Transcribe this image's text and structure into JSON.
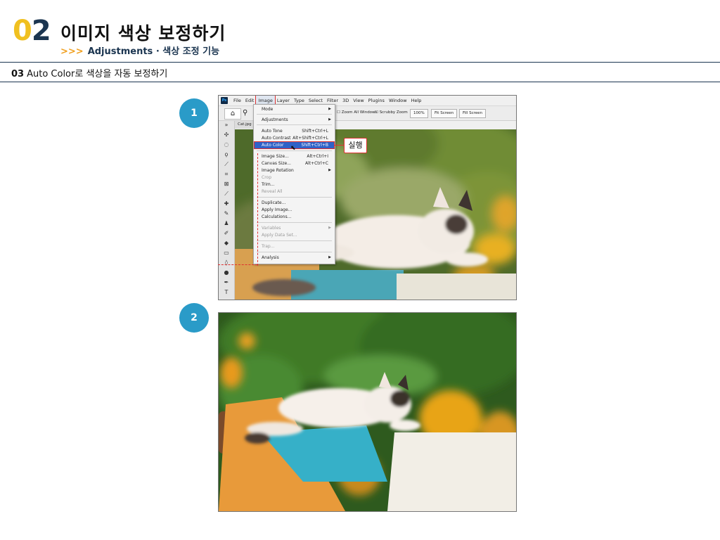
{
  "header": {
    "chapter_num_a": "0",
    "chapter_num_b": "2",
    "title": "이미지 색상 보정하기",
    "subtitle_arrows": ">>>",
    "subtitle": "Adjustments · 색상 조정 기능"
  },
  "step": {
    "number": "03",
    "title": "Auto Color로 색상을 자동 보정하기"
  },
  "badges": [
    "1",
    "2"
  ],
  "photoshop": {
    "logo": "Ps",
    "menubar": [
      "File",
      "Edit",
      "Image",
      "Layer",
      "Type",
      "Select",
      "Filter",
      "3D",
      "View",
      "Plugins",
      "Window",
      "Help"
    ],
    "active_menu": "Image",
    "options": {
      "zoom_all": "Zoom All Windows",
      "scrubby": "Scrubby Zoom",
      "zoom_pct": "100%",
      "fit": "Fit Screen",
      "fill": "Fill Screen"
    },
    "doc_tab": "Cat.jpg",
    "image_menu": {
      "mode": "Mode",
      "adjustments": "Adjustments",
      "auto_tone": {
        "label": "Auto Tone",
        "shortcut": "Shift+Ctrl+L"
      },
      "auto_contrast": {
        "label": "Auto Contrast",
        "shortcut": "Alt+Shift+Ctrl+L"
      },
      "auto_color": {
        "label": "Auto Color",
        "shortcut": "Shift+Ctrl+B"
      },
      "image_size": {
        "label": "Image Size...",
        "shortcut": "Alt+Ctrl+I"
      },
      "canvas_size": {
        "label": "Canvas Size...",
        "shortcut": "Alt+Ctrl+C"
      },
      "image_rotation": "Image Rotation",
      "crop": "Crop",
      "trim": "Trim...",
      "reveal_all": "Reveal All",
      "duplicate": "Duplicate...",
      "apply_image": "Apply Image...",
      "calculations": "Calculations...",
      "variables": "Variables",
      "apply_data_set": "Apply Data Set...",
      "trap": "Trap...",
      "analysis": "Analysis"
    },
    "callout": "실행"
  },
  "colors": {
    "accent_blue": "#2a9bc8",
    "navy": "#1b3550",
    "yellow": "#f0c020",
    "highlight_red": "#e03030",
    "menu_selection": "#2f62c8"
  }
}
